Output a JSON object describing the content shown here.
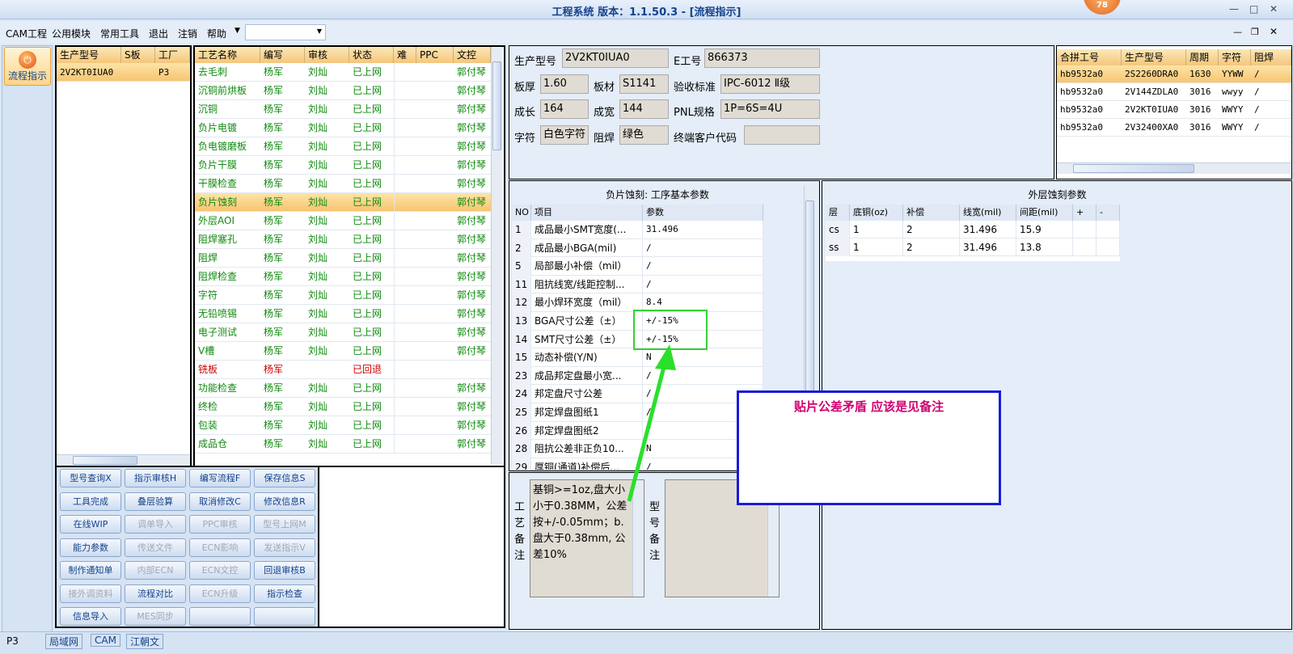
{
  "window": {
    "title": "工程系统  版本：1.1.50.3 - [流程指示]",
    "badge": "78"
  },
  "menu": {
    "items": [
      "CAM工程",
      "公用模块",
      "常用工具",
      "退出",
      "注销",
      "帮助"
    ],
    "dropdown_value": ""
  },
  "left_nav": {
    "button_label": "流程指示"
  },
  "model_list": {
    "headers": [
      "生产型号",
      "S板",
      "工厂"
    ],
    "rows": [
      {
        "model": "2V2KT0IUA0",
        "s": "",
        "factory": "P3"
      }
    ]
  },
  "process": {
    "headers": [
      "工艺名称",
      "编写",
      "审核",
      "状态",
      "难",
      "PPC",
      "文控"
    ],
    "rows": [
      {
        "name": "去毛刺",
        "writer": "杨军",
        "reviewer": "刘灿",
        "status": "已上网",
        "ppc": "",
        "doc": "郭付琴"
      },
      {
        "name": "沉铜前烘板",
        "writer": "杨军",
        "reviewer": "刘灿",
        "status": "已上网",
        "ppc": "",
        "doc": "郭付琴"
      },
      {
        "name": "沉铜",
        "writer": "杨军",
        "reviewer": "刘灿",
        "status": "已上网",
        "ppc": "",
        "doc": "郭付琴"
      },
      {
        "name": "负片电镀",
        "writer": "杨军",
        "reviewer": "刘灿",
        "status": "已上网",
        "ppc": "",
        "doc": "郭付琴"
      },
      {
        "name": "负电镀磨板",
        "writer": "杨军",
        "reviewer": "刘灿",
        "status": "已上网",
        "ppc": "",
        "doc": "郭付琴"
      },
      {
        "name": "负片干膜",
        "writer": "杨军",
        "reviewer": "刘灿",
        "status": "已上网",
        "ppc": "",
        "doc": "郭付琴"
      },
      {
        "name": "干膜检查",
        "writer": "杨军",
        "reviewer": "刘灿",
        "status": "已上网",
        "ppc": "",
        "doc": "郭付琴"
      },
      {
        "name": "负片蚀刻",
        "writer": "杨军",
        "reviewer": "刘灿",
        "status": "已上网",
        "ppc": "",
        "doc": "郭付琴"
      },
      {
        "name": "外层AOI",
        "writer": "杨军",
        "reviewer": "刘灿",
        "status": "已上网",
        "ppc": "",
        "doc": "郭付琴"
      },
      {
        "name": "阻焊塞孔",
        "writer": "杨军",
        "reviewer": "刘灿",
        "status": "已上网",
        "ppc": "",
        "doc": "郭付琴"
      },
      {
        "name": "阻焊",
        "writer": "杨军",
        "reviewer": "刘灿",
        "status": "已上网",
        "ppc": "",
        "doc": "郭付琴"
      },
      {
        "name": "阻焊检查",
        "writer": "杨军",
        "reviewer": "刘灿",
        "status": "已上网",
        "ppc": "",
        "doc": "郭付琴"
      },
      {
        "name": "字符",
        "writer": "杨军",
        "reviewer": "刘灿",
        "status": "已上网",
        "ppc": "",
        "doc": "郭付琴"
      },
      {
        "name": "无铅喷锡",
        "writer": "杨军",
        "reviewer": "刘灿",
        "status": "已上网",
        "ppc": "",
        "doc": "郭付琴"
      },
      {
        "name": "电子测试",
        "writer": "杨军",
        "reviewer": "刘灿",
        "status": "已上网",
        "ppc": "",
        "doc": "郭付琴"
      },
      {
        "name": "V槽",
        "writer": "杨军",
        "reviewer": "刘灿",
        "status": "已上网",
        "ppc": "",
        "doc": "郭付琴"
      },
      {
        "name": "铣板",
        "writer": "杨军",
        "reviewer": "",
        "status": "已回退",
        "ppc": "",
        "doc": ""
      },
      {
        "name": "功能检查",
        "writer": "杨军",
        "reviewer": "刘灿",
        "status": "已上网",
        "ppc": "",
        "doc": "郭付琴"
      },
      {
        "name": "终检",
        "writer": "杨军",
        "reviewer": "刘灿",
        "status": "已上网",
        "ppc": "",
        "doc": "郭付琴"
      },
      {
        "name": "包装",
        "writer": "杨军",
        "reviewer": "刘灿",
        "status": "已上网",
        "ppc": "",
        "doc": "郭付琴"
      },
      {
        "name": "成品仓",
        "writer": "杨军",
        "reviewer": "刘灿",
        "status": "已上网",
        "ppc": "",
        "doc": "郭付琴"
      }
    ]
  },
  "buttons": [
    {
      "label": "型号查询X",
      "enabled": true
    },
    {
      "label": "指示审核H",
      "enabled": true
    },
    {
      "label": "编写流程F",
      "enabled": true
    },
    {
      "label": "保存信息S",
      "enabled": true
    },
    {
      "label": "工具完成",
      "enabled": true
    },
    {
      "label": "叠层验算",
      "enabled": true
    },
    {
      "label": "取消修改C",
      "enabled": true
    },
    {
      "label": "修改信息R",
      "enabled": true
    },
    {
      "label": "在线WIP",
      "enabled": true
    },
    {
      "label": "调单导入",
      "enabled": false
    },
    {
      "label": "PPC审核",
      "enabled": false
    },
    {
      "label": "型号上网M",
      "enabled": false
    },
    {
      "label": "能力参数",
      "enabled": true
    },
    {
      "label": "传送文件",
      "enabled": false
    },
    {
      "label": "ECN影响",
      "enabled": false
    },
    {
      "label": "发送指示V",
      "enabled": false
    },
    {
      "label": "制作通知单",
      "enabled": true
    },
    {
      "label": "内部ECN",
      "enabled": false
    },
    {
      "label": "ECN文控",
      "enabled": false
    },
    {
      "label": "回退审核B",
      "enabled": true
    },
    {
      "label": "接外调资料",
      "enabled": false
    },
    {
      "label": "流程对比",
      "enabled": true
    },
    {
      "label": "ECN升级",
      "enabled": false
    },
    {
      "label": "指示检查",
      "enabled": true
    },
    {
      "label": "信息导入",
      "enabled": true
    },
    {
      "label": "MES同步",
      "enabled": false
    },
    {
      "label": "",
      "enabled": true
    },
    {
      "label": "",
      "enabled": true
    }
  ],
  "info": {
    "model_label": "生产型号",
    "model": "2V2KT0IUA0",
    "eno_label": "E工号",
    "eno": "866373",
    "thick_label": "板厚",
    "thick": "1.60",
    "mat_label": "板材",
    "mat": "S1141",
    "std_label": "验收标准",
    "std": "IPC-6012 Ⅱ级",
    "len_label": "成长",
    "len": "164",
    "wid_label": "成宽",
    "wid": "144",
    "pnl_label": "PNL规格",
    "pnl": "1P=6S=4U",
    "char_label": "字符",
    "char": "白色字符",
    "mask_label": "阻焊",
    "mask": "绿色",
    "cust_label": "终端客户代码",
    "cust": ""
  },
  "combo_table": {
    "headers": [
      "合拼工号",
      "生产型号",
      "周期",
      "字符",
      "阻焊"
    ],
    "rows": [
      {
        "job": "hb9532a0",
        "model": "2S2260DRA0",
        "period": "1630",
        "char": "YYWW",
        "mask": "/"
      },
      {
        "job": "hb9532a0",
        "model": "2V144ZDLA0",
        "period": "3016",
        "char": "wwyy",
        "mask": "/"
      },
      {
        "job": "hb9532a0",
        "model": "2V2KT0IUA0",
        "period": "3016",
        "char": "WWYY",
        "mask": "/"
      },
      {
        "job": "hb9532a0",
        "model": "2V32400XA0",
        "period": "3016",
        "char": "WWYY",
        "mask": "/"
      }
    ]
  },
  "params": {
    "title": "负片蚀刻: 工序基本参数",
    "headers": [
      "NO",
      "项目",
      "参数"
    ],
    "rows": [
      {
        "no": "1",
        "item": "成品最小SMT宽度(...",
        "val": "31.496"
      },
      {
        "no": "2",
        "item": "成品最小BGA(mil)",
        "val": "/"
      },
      {
        "no": "5",
        "item": "局部最小补偿（mil）",
        "val": "/"
      },
      {
        "no": "11",
        "item": "阻抗线宽/线距控制...",
        "val": "/"
      },
      {
        "no": "12",
        "item": "最小焊环宽度（mil）",
        "val": "8.4"
      },
      {
        "no": "13",
        "item": "BGA尺寸公差（±）",
        "val": "+/-15%"
      },
      {
        "no": "14",
        "item": "SMT尺寸公差（±）",
        "val": "+/-15%"
      },
      {
        "no": "15",
        "item": "动态补偿(Y/N)",
        "val": "N"
      },
      {
        "no": "23",
        "item": "成品邦定盘最小宽...",
        "val": "/"
      },
      {
        "no": "24",
        "item": "邦定盘尺寸公差",
        "val": "/"
      },
      {
        "no": "25",
        "item": "邦定焊盘图纸1",
        "val": "/"
      },
      {
        "no": "26",
        "item": "邦定焊盘图纸2",
        "val": "/"
      },
      {
        "no": "28",
        "item": "阻抗公差非正负10...",
        "val": "N"
      },
      {
        "no": "29",
        "item": "厚铜(通道)补偿后...",
        "val": "/"
      }
    ]
  },
  "etch": {
    "title": "外层蚀刻参数",
    "headers": [
      "层",
      "底铜(oz)",
      "补偿",
      "线宽(mil)",
      "间距(mil)",
      "+",
      "-"
    ],
    "rows": [
      {
        "layer": "cs",
        "base": "1",
        "comp": "2",
        "width": "31.496",
        "space": "15.9"
      },
      {
        "layer": "ss",
        "base": "1",
        "comp": "2",
        "width": "31.496",
        "space": "13.8"
      }
    ]
  },
  "notes": {
    "proc_label": [
      "工",
      "艺",
      "备",
      "注"
    ],
    "proc_text": "基铜>=1oz,盘大小小于0.38MM，公差按+/-0.05mm；b.盘大于0.38mm, 公差10%",
    "model_label": [
      "型",
      "号",
      "备",
      "注"
    ],
    "model_text": ""
  },
  "annotation": {
    "text": "贴片公差矛盾    应该是见备注",
    "color": "#d0006f"
  },
  "status_tabs": [
    "P3",
    "局域网",
    "CAM",
    "江朝文"
  ]
}
